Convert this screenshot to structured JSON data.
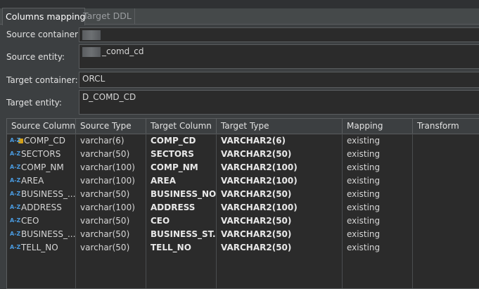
{
  "tabs": [
    {
      "label": "Columns mapping",
      "active": true
    },
    {
      "label": "Target DDL",
      "active": false
    }
  ],
  "form": {
    "source_container_label": "Source container:",
    "source_container_value": "",
    "source_entity_label": "Source entity:",
    "source_entity_value": "_comd_cd",
    "target_container_label": "Target container:",
    "target_container_value": "ORCL",
    "target_entity_label": "Target entity:",
    "target_entity_value": "D_COMD_CD"
  },
  "grid": {
    "headers": [
      "Source Column",
      "Source Type",
      "Target Column",
      "Target Type",
      "Mapping",
      "Transform"
    ],
    "rows": [
      {
        "icon": "primary-key-column-icon",
        "source_column": "COMP_CD",
        "source_type": "varchar(6)",
        "target_column": "COMP_CD",
        "target_type": "VARCHAR2(6)",
        "mapping": "existing",
        "transform": ""
      },
      {
        "icon": "az-column-icon",
        "source_column": "SECTORS",
        "source_type": "varchar(50)",
        "target_column": "SECTORS",
        "target_type": "VARCHAR2(50)",
        "mapping": "existing",
        "transform": ""
      },
      {
        "icon": "az-column-icon",
        "source_column": "COMP_NM",
        "source_type": "varchar(100)",
        "target_column": "COMP_NM",
        "target_type": "VARCHAR2(100)",
        "mapping": "existing",
        "transform": ""
      },
      {
        "icon": "az-column-icon",
        "source_column": "AREA",
        "source_type": "varchar(100)",
        "target_column": "AREA",
        "target_type": "VARCHAR2(100)",
        "mapping": "existing",
        "transform": ""
      },
      {
        "icon": "az-column-icon",
        "source_column": "BUSINESS_...",
        "source_type": "varchar(50)",
        "target_column": "BUSINESS_NO",
        "target_type": "VARCHAR2(50)",
        "mapping": "existing",
        "transform": ""
      },
      {
        "icon": "az-column-icon",
        "source_column": "ADDRESS",
        "source_type": "varchar(100)",
        "target_column": "ADDRESS",
        "target_type": "VARCHAR2(100)",
        "mapping": "existing",
        "transform": ""
      },
      {
        "icon": "az-column-icon",
        "source_column": "CEO",
        "source_type": "varchar(50)",
        "target_column": "CEO",
        "target_type": "VARCHAR2(50)",
        "mapping": "existing",
        "transform": ""
      },
      {
        "icon": "az-column-icon",
        "source_column": "BUSINESS_...",
        "source_type": "varchar(50)",
        "target_column": "BUSINESS_ST...",
        "target_type": "VARCHAR2(50)",
        "mapping": "existing",
        "transform": ""
      },
      {
        "icon": "az-column-icon",
        "source_column": "TELL_NO",
        "source_type": "varchar(50)",
        "target_column": "TELL_NO",
        "target_type": "VARCHAR2(50)",
        "mapping": "existing",
        "transform": ""
      }
    ]
  }
}
